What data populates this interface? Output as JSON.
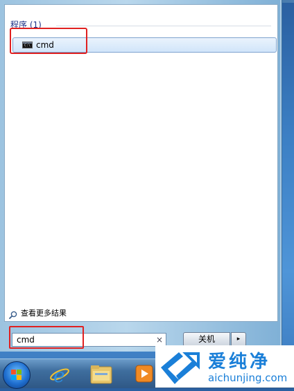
{
  "start_menu": {
    "group_header": "程序 (1)",
    "results": [
      {
        "label": "cmd",
        "icon": "command-prompt-icon"
      }
    ],
    "see_more_label": "查看更多结果",
    "search": {
      "value": "cmd",
      "clear_glyph": "×"
    },
    "shutdown_label": "关机",
    "shutdown_arrow": "▸"
  },
  "taskbar": {
    "items": [
      "start-orb-icon",
      "internet-explorer-icon",
      "folder-icon",
      "media-player-icon"
    ]
  },
  "watermark": {
    "title": "爱纯净",
    "url": "aichunjing.com"
  },
  "colors": {
    "highlight": "#e02020",
    "accent": "#1a7fd8",
    "group_header": "#1e3287"
  }
}
